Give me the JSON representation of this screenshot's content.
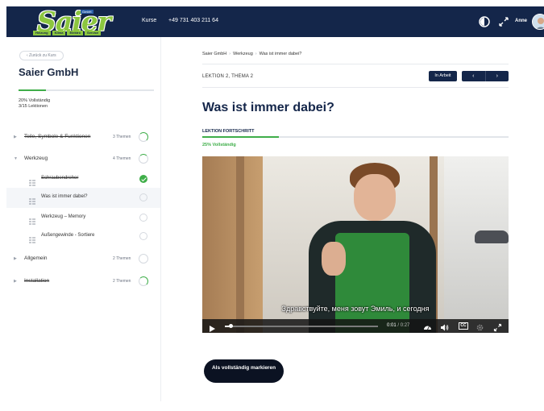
{
  "header": {
    "logo_word": "Saier",
    "logo_tag": "GmbH",
    "logo_strip": [
      "Heizung",
      "Klima",
      "Elektro",
      "Service"
    ],
    "nav_kurse": "Kurse",
    "phone": "+49 731 403 211 64",
    "user_name": "Anne"
  },
  "sidebar": {
    "back_label": "‹  Zurück zu Kurs",
    "course_title": "Saier GmbH",
    "progress_line1": "20% Vollständig",
    "progress_line2": "3/15 Lektionen",
    "progress_fraction": 0.2,
    "topics": [
      {
        "label": "Teile, Symbole & Funktionen",
        "count": "3 Themen"
      },
      {
        "label": "Werkzeug",
        "count": "4 Themen"
      },
      {
        "label": "Allgemein",
        "count": "2 Themen"
      },
      {
        "label": "Installation",
        "count": "2 Themen"
      }
    ],
    "lessons": [
      {
        "label": "Schraubendreher",
        "done": true
      },
      {
        "label": "Was ist immer dabei?",
        "done": false
      },
      {
        "label": "Werkzeug – Memory",
        "done": false
      },
      {
        "label": "Außengewinde - Sortiere",
        "done": false
      }
    ]
  },
  "main": {
    "breadcrumb": [
      "Saier GmbH",
      "Werkzeug",
      "Was ist immer dabei?"
    ],
    "lesson_meta": "LEKTION 2, THEMA 2",
    "status_label": "In Arbeit",
    "prev_label": "‹",
    "next_label": "›",
    "title": "Was ist immer dabei?",
    "lesson_progress_label": "LEKTION FORTSCHRITT",
    "lesson_progress_pct": "25% Vollständig",
    "lesson_progress_fraction": 0.25,
    "complete_button": "Als vollständig markieren"
  },
  "video": {
    "subtitle": "Здравствуйте, меня зовут Эмиль, и сегодня",
    "time_current": "0:01",
    "time_duration": "/ 0:27",
    "cc_label": "CC",
    "played_fraction": 0.037
  },
  "colors": {
    "navy": "#14264a",
    "accent_green": "#3fae49",
    "logo_green": "#8cc63f"
  }
}
